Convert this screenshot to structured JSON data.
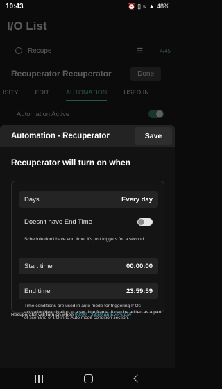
{
  "status_bar": {
    "time": "10:43",
    "battery": "48%",
    "icons": [
      "alarm-icon",
      "vibrate-icon",
      "wifi-icon",
      "signal-icon",
      "battery-icon"
    ]
  },
  "background": {
    "title": "I/O List",
    "search_value": "Recupe",
    "filter_badge": "4/45",
    "item_title": "Recuperator Recuperator",
    "done_label": "Done",
    "tabs": [
      "ISITY",
      "EDIT",
      "AUTOMATION",
      "USED IN"
    ],
    "active_tab": "AUTOMATION",
    "automation_active_label": "Automation Active"
  },
  "sheet": {
    "title": "Automation - Recuperator",
    "save_label": "Save",
    "heading": "Recuperator will turn on when",
    "days_label": "Days",
    "days_value": "Every day",
    "end_time_toggle_label": "Doesn't have End Time",
    "schedule_note": "Schedule don't have end time, it's just triggers for a second.",
    "start_label": "Start time",
    "start_value": "00:00:00",
    "end_label": "End time",
    "end_value": "23:59:59",
    "time_note": "Time conditions are used in auto mode for triggering I/ Os activation/deactivation in a set time frame. It can be added as a part of scenario or I/O in to Auto mode condition section.",
    "summary_prefix": "Recuperator will turn on when",
    "summary_highlight": "00:00 - 23:59 on Every day"
  },
  "colors": {
    "accent": "#5ccfae",
    "summary_highlight": "#49b9d8"
  }
}
